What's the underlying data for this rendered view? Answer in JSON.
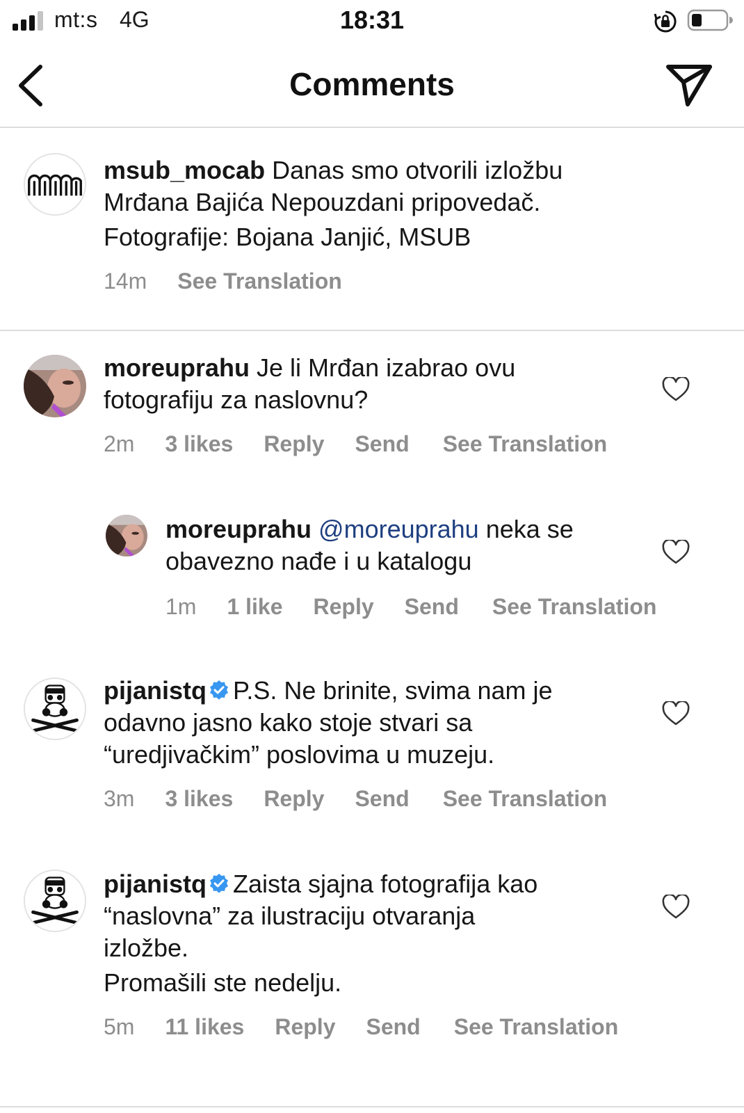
{
  "status_bar": {
    "carrier": "mt:s",
    "network": "4G",
    "time": "18:31"
  },
  "header": {
    "title": "Comments",
    "back_icon": "chevron-left-icon",
    "send_icon": "paper-plane-icon"
  },
  "caption": {
    "username": "msub_mocab",
    "text_line1": " Danas smo otvorili izložbu",
    "text_line2": "Mrđana Bajića Nepouzdani pripovedač.",
    "text_line3": "Fotografije: Bojana Janjić, MSUB",
    "time": "14m",
    "see_translation": "See Translation"
  },
  "comments": [
    {
      "username": "moreuprahu",
      "line1": " Je li Mrđan izabrao ovu",
      "line2": "fotografiju za naslovnu?",
      "time": "2m",
      "likes": "3 likes",
      "reply": "Reply",
      "send": "Send",
      "see_translation": "See Translation"
    },
    {
      "username": "moreuprahu",
      "mention": "@moreuprahu",
      "line1": " neka se",
      "line2": "obavezno nađe i u katalogu",
      "time": "1m",
      "likes": "1 like",
      "reply": "Reply",
      "send": "Send",
      "see_translation": "See Translation"
    },
    {
      "username": "pijanistq",
      "line1": "P.S. Ne brinite, svima nam je",
      "line2": "odavno jasno kako stoje stvari sa",
      "line3": "“uredjivačkim” poslovima u muzeju.",
      "time": "3m",
      "likes": "3 likes",
      "reply": "Reply",
      "send": "Send",
      "see_translation": "See Translation"
    },
    {
      "username": "pijanistq",
      "line1": "Zaista sjajna fotografija kao",
      "line2": "“naslovna” za ilustraciju otvaranja",
      "line3": "izložbe.",
      "line4": "Promašili ste nedelju.",
      "time": "5m",
      "likes": "11 likes",
      "reply": "Reply",
      "send": "Send",
      "see_translation": "See Translation"
    }
  ],
  "colors": {
    "mention": "#1e3f80",
    "verified": "#3897f0",
    "meta": "#8d8d8d",
    "divider": "#dcdcdc"
  }
}
